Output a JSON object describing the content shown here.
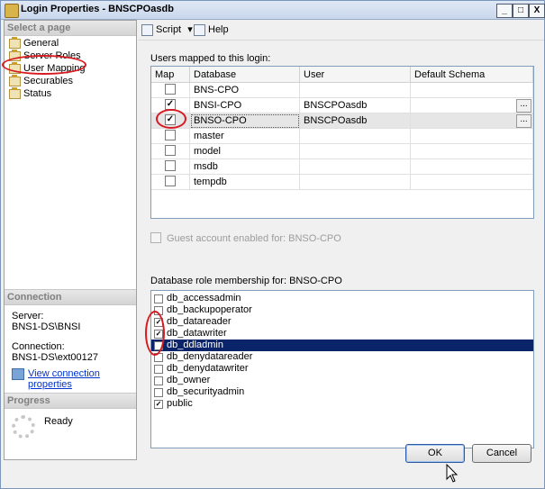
{
  "window": {
    "title": "Login Properties - BNSCPOasdb",
    "buttons": [
      "_",
      "□",
      "X"
    ]
  },
  "left_panel": {
    "select_page_header": "Select a page",
    "pages": [
      {
        "label": "General"
      },
      {
        "label": "Server Roles"
      },
      {
        "label": "User Mapping"
      },
      {
        "label": "Securables"
      },
      {
        "label": "Status"
      }
    ],
    "connection_header": "Connection",
    "server_label": "Server:",
    "server_value": "BNS1-DS\\BNSI",
    "connection_label": "Connection:",
    "connection_value": "BNS1-DS\\ext00127",
    "view_link": "View connection properties",
    "progress_header": "Progress",
    "progress_status": "Ready"
  },
  "toolbar": {
    "script_label": "Script",
    "help_label": "Help"
  },
  "users_mapped": {
    "label": "Users mapped to this login:",
    "columns": [
      "Map",
      "Database",
      "User",
      "Default Schema"
    ],
    "rows": [
      {
        "map": false,
        "database": "BNS-CPO",
        "user": "",
        "schema": ""
      },
      {
        "map": true,
        "database": "BNSI-CPO",
        "user": "BNSCPOasdb",
        "schema": ""
      },
      {
        "map": true,
        "database": "BNSO-CPO",
        "user": "BNSCPOasdb",
        "schema": ""
      },
      {
        "map": false,
        "database": "master",
        "user": "",
        "schema": ""
      },
      {
        "map": false,
        "database": "model",
        "user": "",
        "schema": ""
      },
      {
        "map": false,
        "database": "msdb",
        "user": "",
        "schema": ""
      },
      {
        "map": false,
        "database": "tempdb",
        "user": "",
        "schema": ""
      }
    ],
    "ellipsis": "..."
  },
  "guest_label": "Guest account enabled for: BNSO-CPO",
  "role_membership": {
    "label": "Database role membership for: BNSO-CPO",
    "roles": [
      {
        "name": "db_accessadmin",
        "checked": false
      },
      {
        "name": "db_backupoperator",
        "checked": false
      },
      {
        "name": "db_datareader",
        "checked": true
      },
      {
        "name": "db_datawriter",
        "checked": true
      },
      {
        "name": "db_ddladmin",
        "checked": true
      },
      {
        "name": "db_denydatareader",
        "checked": false
      },
      {
        "name": "db_denydatawriter",
        "checked": false
      },
      {
        "name": "db_owner",
        "checked": false
      },
      {
        "name": "db_securityadmin",
        "checked": false
      },
      {
        "name": "public",
        "checked": true
      }
    ]
  },
  "footer": {
    "ok_label": "OK",
    "cancel_label": "Cancel"
  },
  "colors": {
    "selection": "#0a246a",
    "annotation": "#d71920",
    "link": "#0033cc"
  }
}
